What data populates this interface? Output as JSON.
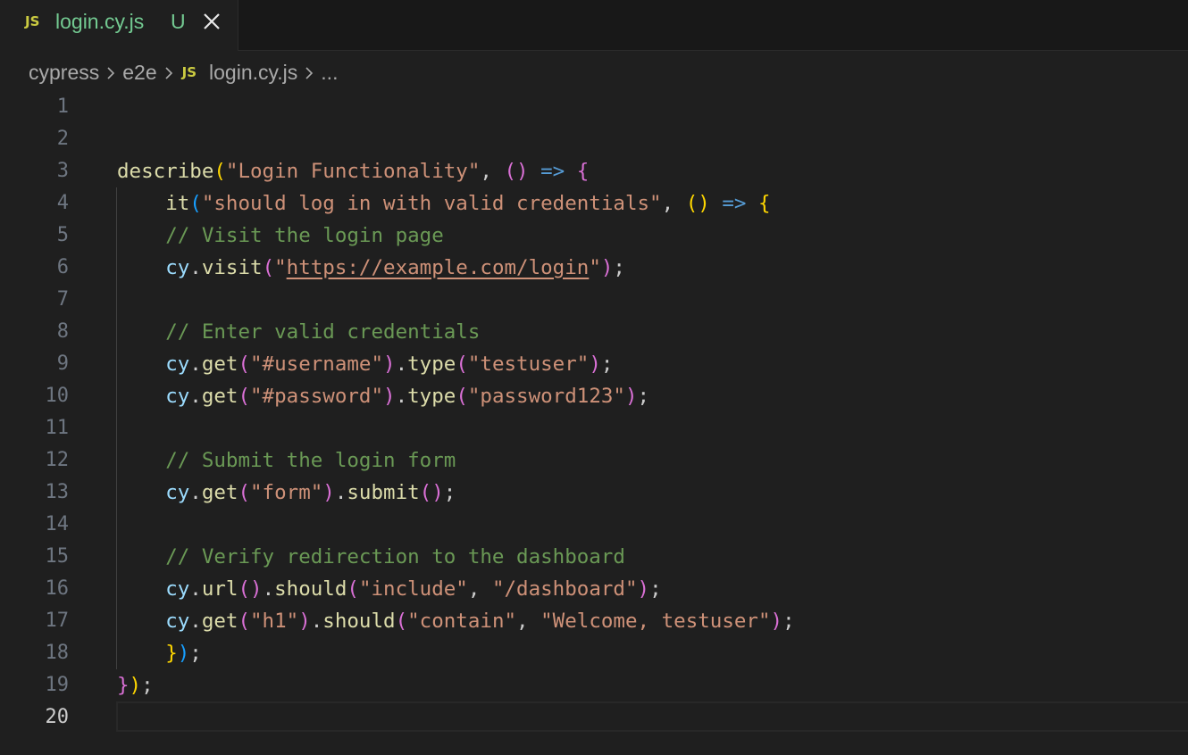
{
  "tab": {
    "icon": "JS",
    "file_name": "login.cy.js",
    "status": "U",
    "close_icon": "close-icon"
  },
  "breadcrumb": {
    "items": [
      "cypress",
      "e2e",
      "login.cy.js",
      "..."
    ],
    "file_icon": "JS"
  },
  "editor": {
    "active_line": 20,
    "line_numbers": [
      "1",
      "2",
      "3",
      "4",
      "5",
      "6",
      "7",
      "8",
      "9",
      "10",
      "11",
      "12",
      "13",
      "14",
      "15",
      "16",
      "17",
      "18",
      "19",
      "20"
    ],
    "lines": [
      [],
      [],
      [
        {
          "t": "describe",
          "c": "fn"
        },
        {
          "t": "(",
          "c": "p1"
        },
        {
          "t": "\"Login Functionality\"",
          "c": "str"
        },
        {
          "t": ", ",
          "c": "txt"
        },
        {
          "t": "()",
          "c": "p2"
        },
        {
          "t": " ",
          "c": "txt"
        },
        {
          "t": "=>",
          "c": "kw"
        },
        {
          "t": " ",
          "c": "txt"
        },
        {
          "t": "{",
          "c": "p2"
        }
      ],
      [
        {
          "t": "    ",
          "c": "txt"
        },
        {
          "t": "it",
          "c": "fn"
        },
        {
          "t": "(",
          "c": "p3"
        },
        {
          "t": "\"should log in with valid credentials\"",
          "c": "str"
        },
        {
          "t": ", ",
          "c": "txt"
        },
        {
          "t": "()",
          "c": "p1"
        },
        {
          "t": " ",
          "c": "txt"
        },
        {
          "t": "=>",
          "c": "kw"
        },
        {
          "t": " ",
          "c": "txt"
        },
        {
          "t": "{",
          "c": "p1"
        }
      ],
      [
        {
          "t": "    ",
          "c": "txt"
        },
        {
          "t": "// Visit the login page",
          "c": "cm"
        }
      ],
      [
        {
          "t": "    ",
          "c": "txt"
        },
        {
          "t": "cy",
          "c": "var"
        },
        {
          "t": ".",
          "c": "txt"
        },
        {
          "t": "visit",
          "c": "fn"
        },
        {
          "t": "(",
          "c": "p2"
        },
        {
          "t": "\"",
          "c": "str"
        },
        {
          "t": "https://example.com/login",
          "c": "str link"
        },
        {
          "t": "\"",
          "c": "str"
        },
        {
          "t": ")",
          "c": "p2"
        },
        {
          "t": ";",
          "c": "txt"
        }
      ],
      [],
      [
        {
          "t": "    ",
          "c": "txt"
        },
        {
          "t": "// Enter valid credentials",
          "c": "cm"
        }
      ],
      [
        {
          "t": "    ",
          "c": "txt"
        },
        {
          "t": "cy",
          "c": "var"
        },
        {
          "t": ".",
          "c": "txt"
        },
        {
          "t": "get",
          "c": "fn"
        },
        {
          "t": "(",
          "c": "p2"
        },
        {
          "t": "\"#username\"",
          "c": "str"
        },
        {
          "t": ")",
          "c": "p2"
        },
        {
          "t": ".",
          "c": "txt"
        },
        {
          "t": "type",
          "c": "fn"
        },
        {
          "t": "(",
          "c": "p2"
        },
        {
          "t": "\"testuser\"",
          "c": "str"
        },
        {
          "t": ")",
          "c": "p2"
        },
        {
          "t": ";",
          "c": "txt"
        }
      ],
      [
        {
          "t": "    ",
          "c": "txt"
        },
        {
          "t": "cy",
          "c": "var"
        },
        {
          "t": ".",
          "c": "txt"
        },
        {
          "t": "get",
          "c": "fn"
        },
        {
          "t": "(",
          "c": "p2"
        },
        {
          "t": "\"#password\"",
          "c": "str"
        },
        {
          "t": ")",
          "c": "p2"
        },
        {
          "t": ".",
          "c": "txt"
        },
        {
          "t": "type",
          "c": "fn"
        },
        {
          "t": "(",
          "c": "p2"
        },
        {
          "t": "\"password123\"",
          "c": "str"
        },
        {
          "t": ")",
          "c": "p2"
        },
        {
          "t": ";",
          "c": "txt"
        }
      ],
      [],
      [
        {
          "t": "    ",
          "c": "txt"
        },
        {
          "t": "// Submit the login form",
          "c": "cm"
        }
      ],
      [
        {
          "t": "    ",
          "c": "txt"
        },
        {
          "t": "cy",
          "c": "var"
        },
        {
          "t": ".",
          "c": "txt"
        },
        {
          "t": "get",
          "c": "fn"
        },
        {
          "t": "(",
          "c": "p2"
        },
        {
          "t": "\"form\"",
          "c": "str"
        },
        {
          "t": ")",
          "c": "p2"
        },
        {
          "t": ".",
          "c": "txt"
        },
        {
          "t": "submit",
          "c": "fn"
        },
        {
          "t": "()",
          "c": "p2"
        },
        {
          "t": ";",
          "c": "txt"
        }
      ],
      [],
      [
        {
          "t": "    ",
          "c": "txt"
        },
        {
          "t": "// Verify redirection to the dashboard",
          "c": "cm"
        }
      ],
      [
        {
          "t": "    ",
          "c": "txt"
        },
        {
          "t": "cy",
          "c": "var"
        },
        {
          "t": ".",
          "c": "txt"
        },
        {
          "t": "url",
          "c": "fn"
        },
        {
          "t": "()",
          "c": "p2"
        },
        {
          "t": ".",
          "c": "txt"
        },
        {
          "t": "should",
          "c": "fn"
        },
        {
          "t": "(",
          "c": "p2"
        },
        {
          "t": "\"include\"",
          "c": "str"
        },
        {
          "t": ", ",
          "c": "txt"
        },
        {
          "t": "\"/dashboard\"",
          "c": "str"
        },
        {
          "t": ")",
          "c": "p2"
        },
        {
          "t": ";",
          "c": "txt"
        }
      ],
      [
        {
          "t": "    ",
          "c": "txt"
        },
        {
          "t": "cy",
          "c": "var"
        },
        {
          "t": ".",
          "c": "txt"
        },
        {
          "t": "get",
          "c": "fn"
        },
        {
          "t": "(",
          "c": "p2"
        },
        {
          "t": "\"h1\"",
          "c": "str"
        },
        {
          "t": ")",
          "c": "p2"
        },
        {
          "t": ".",
          "c": "txt"
        },
        {
          "t": "should",
          "c": "fn"
        },
        {
          "t": "(",
          "c": "p2"
        },
        {
          "t": "\"contain\"",
          "c": "str"
        },
        {
          "t": ", ",
          "c": "txt"
        },
        {
          "t": "\"Welcome, testuser\"",
          "c": "str"
        },
        {
          "t": ")",
          "c": "p2"
        },
        {
          "t": ";",
          "c": "txt"
        }
      ],
      [
        {
          "t": "    ",
          "c": "txt"
        },
        {
          "t": "}",
          "c": "p1"
        },
        {
          "t": ")",
          "c": "p3"
        },
        {
          "t": ";",
          "c": "txt"
        }
      ],
      [
        {
          "t": "}",
          "c": "p2"
        },
        {
          "t": ")",
          "c": "p1"
        },
        {
          "t": ";",
          "c": "txt"
        }
      ],
      []
    ]
  },
  "colors": {
    "background": "#1f1f1f",
    "tab_bar": "#181818",
    "modified_file": "#73c991",
    "js_icon": "#cbcb41",
    "function": "#dcdcaa",
    "string": "#ce9178",
    "comment": "#6a9955",
    "variable": "#9cdcfe",
    "keyword": "#569cd6"
  }
}
